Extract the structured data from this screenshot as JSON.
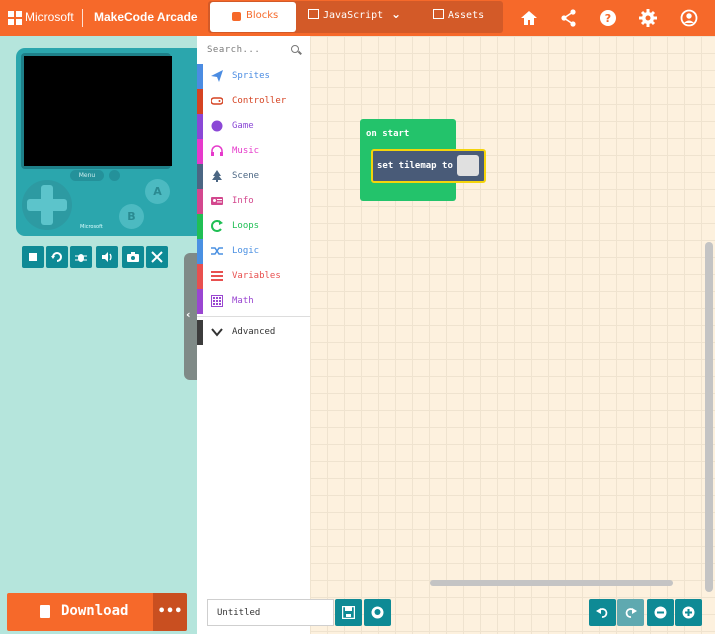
{
  "header": {
    "brand": "Microsoft",
    "app_title": "MakeCode Arcade",
    "tabs": {
      "blocks": "Blocks",
      "javascript": "JavaScript",
      "assets": "Assets"
    },
    "icons": [
      "home-icon",
      "share-icon",
      "help-icon",
      "settings-icon",
      "user-icon"
    ]
  },
  "simulator": {
    "menu_label": "Menu",
    "button_a": "A",
    "button_b": "B",
    "console_brand": "Microsoft",
    "toolbar_icons": [
      "stop-icon",
      "restart-icon",
      "debug-icon",
      "sound-icon",
      "screenshot-icon",
      "fullscreen-icon"
    ]
  },
  "actions": {
    "download": "Download",
    "more": "•••"
  },
  "toolbox": {
    "search_placeholder": "Search...",
    "categories": [
      {
        "label": "Sprites",
        "color": "#4b8ce2"
      },
      {
        "label": "Controller",
        "color": "#d54322"
      },
      {
        "label": "Game",
        "color": "#8b48d6"
      },
      {
        "label": "Music",
        "color": "#e63acb"
      },
      {
        "label": "Scene",
        "color": "#4b6683"
      },
      {
        "label": "Info",
        "color": "#d3488e"
      },
      {
        "label": "Loops",
        "color": "#20bf55"
      },
      {
        "label": "Logic",
        "color": "#4a90e2"
      },
      {
        "label": "Variables",
        "color": "#e8504f"
      },
      {
        "label": "Math",
        "color": "#9a46d1"
      }
    ],
    "advanced": "Advanced"
  },
  "workspace": {
    "on_start": "on start",
    "set_tilemap": "set tilemap to"
  },
  "footer": {
    "project_name": "Untitled"
  },
  "colors": {
    "accent": "#f6692a",
    "teal": "#0e8a95"
  }
}
